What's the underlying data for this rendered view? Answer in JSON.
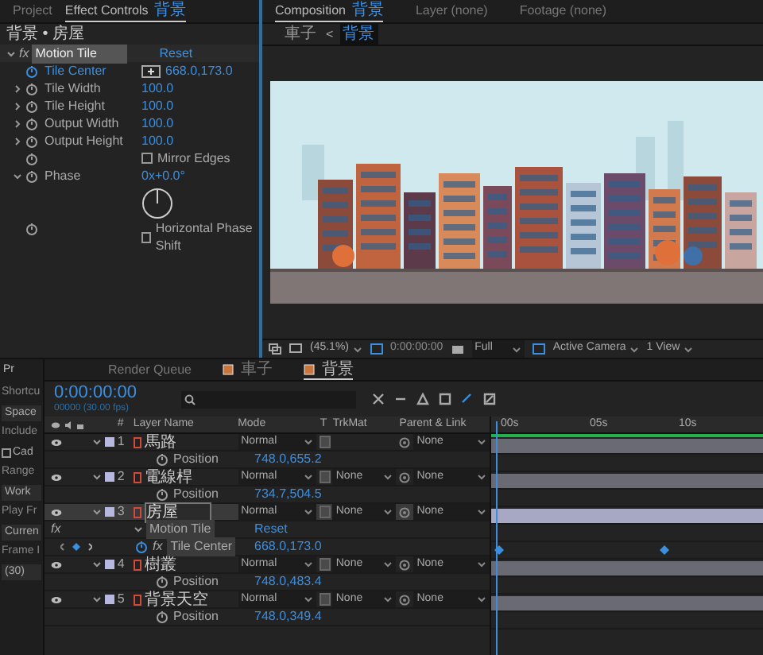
{
  "effect_panel": {
    "tabs": [
      {
        "label": "Project",
        "selected": false
      },
      {
        "label": "Effect Controls",
        "comp": "背景",
        "selected": true
      }
    ],
    "layer_path": "背景 • 房屋",
    "effect": {
      "fx": "fx",
      "name": "Motion Tile",
      "reset": "Reset"
    },
    "params": [
      {
        "kind": "point",
        "label": "Tile Center",
        "value": "668.0,173.0",
        "keyframed": true
      },
      {
        "kind": "number",
        "label": "Tile Width",
        "value": "100.0",
        "expanded": false,
        "keyframed": false
      },
      {
        "kind": "number",
        "label": "Tile Height",
        "value": "100.0",
        "expanded": false,
        "keyframed": false
      },
      {
        "kind": "number",
        "label": "Output Width",
        "value": "100.0",
        "expanded": false,
        "keyframed": false
      },
      {
        "kind": "number",
        "label": "Output Height",
        "value": "100.0",
        "expanded": false,
        "keyframed": false
      },
      {
        "kind": "checkbox",
        "label": "Mirror Edges",
        "checked": false,
        "keyframed": false
      },
      {
        "kind": "angle",
        "label": "Phase",
        "value": "0x+0.0°",
        "expanded": true,
        "keyframed": false
      },
      {
        "kind": "checkbox",
        "label": "Horizontal Phase Shift",
        "checked": false,
        "keyframed": false
      }
    ]
  },
  "composition": {
    "tabs": [
      {
        "label": "Composition",
        "name": "背景",
        "selected": true
      },
      {
        "label": "Layer (none)",
        "selected": false
      },
      {
        "label": "Footage (none)",
        "selected": false
      }
    ],
    "breadcrumb": [
      {
        "label": "車子",
        "selected": false
      },
      {
        "label": "背景",
        "selected": true
      }
    ],
    "separator": "<",
    "toolbar": {
      "zoom": "(45.1%)",
      "timecode": "0:00:00:00",
      "resolution": "Full",
      "camera": "Active Camera",
      "views": "1 View"
    }
  },
  "side_panel": [
    {
      "kind": "tab",
      "text": "Pr"
    },
    {
      "kind": "heading",
      "text": "Shortcu"
    },
    {
      "kind": "field",
      "text": "Space"
    },
    {
      "kind": "heading",
      "text": "Include"
    },
    {
      "kind": "checkbox",
      "text": "Cad",
      "checked": false
    },
    {
      "kind": "heading",
      "text": "Range"
    },
    {
      "kind": "field",
      "text": "Work"
    },
    {
      "kind": "heading",
      "text": "Play Fr"
    },
    {
      "kind": "field",
      "text": "Curren"
    },
    {
      "kind": "heading",
      "text": "Frame I"
    },
    {
      "kind": "field",
      "text": "(30)"
    }
  ],
  "timeline": {
    "tabs": [
      {
        "label": "Render Queue",
        "selected": false
      },
      {
        "label": "車子",
        "selected": false
      },
      {
        "label": "背景",
        "selected": true
      }
    ],
    "timecode": "0:00:00:00",
    "frame_info": "00000 (30.00 fps)",
    "columns": {
      "number": "#",
      "name": "Layer Name",
      "mode": "Mode",
      "t": "T",
      "trkmat": "TrkMat",
      "parent": "Parent & Link"
    },
    "ruler": [
      "00s",
      "05s",
      "10s"
    ],
    "rows": [
      {
        "kind": "layer",
        "number": "1",
        "name": "馬路",
        "mode": "Normal",
        "parent": "None",
        "selected": false
      },
      {
        "kind": "property",
        "name": "Position",
        "value": "748.0,655.2",
        "keyframed": false
      },
      {
        "kind": "layer",
        "number": "2",
        "name": "電線桿",
        "mode": "Normal",
        "trkmat": "None",
        "parent": "None",
        "selected": false
      },
      {
        "kind": "property",
        "name": "Position",
        "value": "734.7,504.5",
        "keyframed": false
      },
      {
        "kind": "layer",
        "number": "3",
        "name": "房屋",
        "mode": "Normal",
        "trkmat": "None",
        "parent": "None",
        "selected": true
      },
      {
        "kind": "effect",
        "fx": "fx",
        "name": "Motion Tile",
        "reset": "Reset"
      },
      {
        "kind": "property",
        "fx": "fx",
        "name": "Tile Center",
        "value": "668.0,173.0",
        "keyframed": true
      },
      {
        "kind": "layer",
        "number": "4",
        "name": "樹叢",
        "mode": "Normal",
        "trkmat": "None",
        "parent": "None",
        "selected": false
      },
      {
        "kind": "property",
        "name": "Position",
        "value": "748.0,483.4",
        "keyframed": false
      },
      {
        "kind": "layer",
        "number": "5",
        "name": "背景天空",
        "mode": "Normal",
        "trkmat": "None",
        "parent": "None",
        "selected": false
      },
      {
        "kind": "property",
        "name": "Position",
        "value": "748.0,349.4",
        "keyframed": false
      }
    ]
  }
}
